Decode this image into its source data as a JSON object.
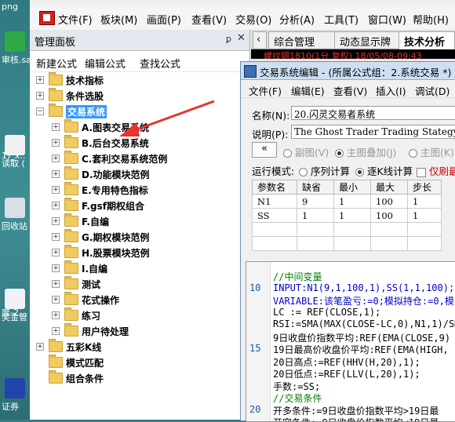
{
  "desktop": {
    "icons": [
      {
        "label": "png",
        "color": "#ddeeff"
      },
      {
        "label": "审核.sa",
        "color": "#2eaa44"
      },
      {
        "label": "读取 (",
        "color": "#f0f0f0"
      },
      {
        "label": "1)_x..",
        "color": "#2a5a9a"
      },
      {
        "label": "回收站",
        "color": "#d8e0e6"
      },
      {
        "label": "奖金管",
        "color": "#eef2f8"
      },
      {
        "label": "度-2...",
        "color": "#eef2f8"
      },
      {
        "label": "证券",
        "color": "#2244aa"
      }
    ]
  },
  "menubar": {
    "items": [
      "文件(F)",
      "板块(M)",
      "画面(P)",
      "查看(V)",
      "交易(O)",
      "分析(A)",
      "工具(T)",
      "窗口(W)",
      "帮助(H)"
    ]
  },
  "panel": {
    "title": "管理面板",
    "pin": "ꝑ",
    "close": "✕",
    "toolbar": [
      "新建公式",
      "编辑公式",
      "查找公式"
    ],
    "tree": [
      {
        "label": "技术指标",
        "level": 0,
        "expanded": false,
        "selected": false
      },
      {
        "label": "条件选股",
        "level": 0,
        "expanded": false,
        "selected": false
      },
      {
        "label": "交易系统",
        "level": 0,
        "expanded": true,
        "selected": true
      },
      {
        "label": "A.图表交易系统",
        "level": 1,
        "expanded": false,
        "selected": false
      },
      {
        "label": "B.后台交易系统",
        "level": 1,
        "expanded": false,
        "selected": false
      },
      {
        "label": "C.套利交易系统范例",
        "level": 1,
        "expanded": false,
        "selected": false
      },
      {
        "label": "D.功能模块范例",
        "level": 1,
        "expanded": false,
        "selected": false
      },
      {
        "label": "E.专用特色指标",
        "level": 1,
        "expanded": false,
        "selected": false
      },
      {
        "label": "F.gsf期权组合",
        "level": 1,
        "expanded": false,
        "selected": false
      },
      {
        "label": "F.自编",
        "level": 1,
        "expanded": false,
        "selected": false
      },
      {
        "label": "G.期权模块范例",
        "level": 1,
        "expanded": false,
        "selected": false
      },
      {
        "label": "H.股票模块范例",
        "level": 1,
        "expanded": false,
        "selected": false
      },
      {
        "label": "I.自编",
        "level": 1,
        "expanded": false,
        "selected": false
      },
      {
        "label": "测试",
        "level": 1,
        "expanded": false,
        "selected": false
      },
      {
        "label": "花式操作",
        "level": 1,
        "expanded": false,
        "selected": false
      },
      {
        "label": "练习",
        "level": 1,
        "expanded": false,
        "selected": false
      },
      {
        "label": "用户待处理",
        "level": 1,
        "expanded": false,
        "selected": false
      },
      {
        "label": "五彩K线",
        "level": 0,
        "expanded": false,
        "selected": false
      },
      {
        "label": "模式匹配",
        "level": 0,
        "leaf": true,
        "selected": false
      },
      {
        "label": "组合条件",
        "level": 0,
        "leaf": true,
        "selected": false
      }
    ]
  },
  "main": {
    "tabs": [
      "综合管理",
      "动态显示牌",
      "技术分析"
    ],
    "active_tab": "技术分析",
    "quote_line": "螺纹钢1810(1分  复权) 18/05/08-09:43"
  },
  "dialog": {
    "title": "交易系统编辑 - (所属公式组：2.系统交易 *)",
    "menu": [
      "文件(F)",
      "编辑(E)",
      "查看(V)",
      "插入(I)",
      "调试(D)"
    ],
    "name_label": "名称(N):",
    "name_value": "20.闪灵交易者系统",
    "desc_label": "说明(P):",
    "desc_value": "The Ghost Trader Trading Stategy",
    "collapse_button": "«",
    "chart_modes": [
      {
        "label": "副图(V)",
        "checked": false
      },
      {
        "label": "主图叠加(J)",
        "checked": true
      },
      {
        "label": "主图(K)",
        "checked": false
      }
    ],
    "run_mode_label": "运行模式:",
    "run_modes": [
      {
        "label": "序列计算",
        "checked": false
      },
      {
        "label": "逐K线计算",
        "checked": true
      }
    ],
    "only_latest_label": "仅刷最",
    "params": {
      "headers": [
        "参数名",
        "缺省",
        "最小",
        "最大",
        "步长"
      ],
      "rows": [
        [
          "N1",
          "9",
          "1",
          "100",
          "1"
        ],
        [
          "SS",
          "1",
          "1",
          "100",
          "1"
        ],
        [
          "",
          "",
          "",
          "",
          ""
        ],
        [
          "",
          "",
          "",
          "",
          ""
        ]
      ]
    },
    "code": {
      "line_numbers": [
        "",
        "10",
        "",
        "",
        "",
        "",
        "15",
        "",
        "",
        "",
        "",
        "20"
      ],
      "lines": [
        {
          "text": "//中间变量",
          "type": "comment"
        },
        {
          "text": "INPUT:N1(9,1,100,1),SS(1,1,100);",
          "type": "keyword"
        },
        {
          "text": "VARIABLE:该笔盈亏:=0;模拟持仓:=0,模",
          "type": "keyword"
        },
        {
          "text": "LC := REF(CLOSE,1);",
          "type": "plain"
        },
        {
          "text": "RSI:=SMA(MAX(CLOSE-LC,0),N1,1)/SMA",
          "type": "plain"
        },
        {
          "text": "9日收盘价指数平均:REF(EMA(CLOSE,9)",
          "type": "plain"
        },
        {
          "text": "19日最高价收盘价平均:REF(EMA(HIGH,",
          "type": "plain"
        },
        {
          "text": "20日高点:=REF(HHV(H,20),1);",
          "type": "plain"
        },
        {
          "text": "20日低点:=REF(LLV(L,20),1);",
          "type": "plain"
        },
        {
          "text": "手数:=SS;",
          "type": "plain"
        },
        {
          "text": "//交易条件",
          "type": "comment"
        },
        {
          "text": "开多条件:=9日收盘价指数平均>19日最",
          "type": "plain"
        },
        {
          "text": "开空条件:=9日收盘价指数平均<19日最",
          "type": "plain"
        }
      ]
    }
  }
}
